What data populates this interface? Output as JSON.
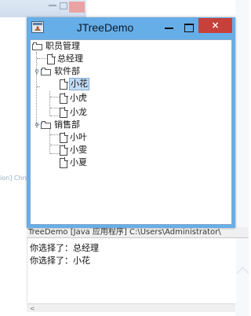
{
  "window": {
    "title": "JTreeDemo",
    "close_glyph": "×"
  },
  "tree": {
    "root": {
      "label": "职员管理",
      "icon": "folder-icon"
    },
    "items": [
      {
        "label": "总经理",
        "icon": "leaf-icon",
        "selected": false
      },
      {
        "label": "软件部",
        "icon": "folder-icon",
        "expanded": true
      },
      {
        "label": "小花",
        "icon": "leaf-icon",
        "selected": true
      },
      {
        "label": "小虎",
        "icon": "leaf-icon",
        "selected": false
      },
      {
        "label": "小龙",
        "icon": "leaf-icon",
        "selected": false
      },
      {
        "label": "销售部",
        "icon": "folder-icon",
        "expanded": true
      },
      {
        "label": "小叶",
        "icon": "leaf-icon",
        "selected": false
      },
      {
        "label": "小雯",
        "icon": "leaf-icon",
        "selected": false
      },
      {
        "label": "小夏",
        "icon": "leaf-icon",
        "selected": false
      }
    ]
  },
  "console": {
    "title": "TreeDemo [Java 应用程序] C:\\Users\\Administrator\\",
    "lines": [
      "你选择了：总经理",
      "你选择了：小花"
    ]
  },
  "background": {
    "left_fragment": "ion] Chro"
  },
  "colors": {
    "titlebar": "#66aee8",
    "close_button": "#c7403a",
    "selection": "#c3dcf5"
  }
}
